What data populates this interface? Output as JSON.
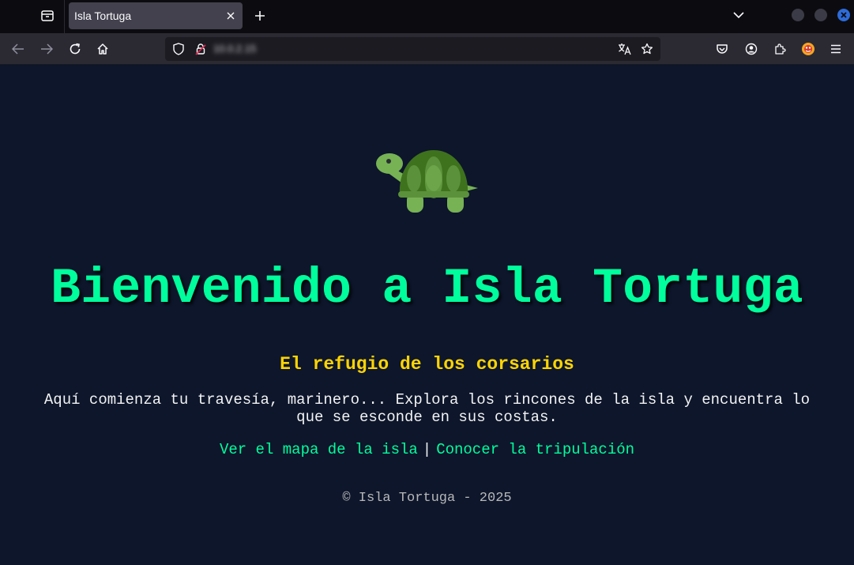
{
  "browser": {
    "tab": {
      "title": "Isla Tortuga"
    },
    "url": "10.0.2.15",
    "icons": {
      "tab_list": "tab-list-icon",
      "close_tab": "close-icon",
      "new_tab": "plus-icon",
      "overflow": "chevron-down-icon",
      "back": "back-arrow-icon",
      "forward": "forward-arrow-icon",
      "reload": "reload-icon",
      "home": "home-icon",
      "shield": "shield-icon",
      "lock": "lock-icon",
      "translate": "translate-icon",
      "bookmark": "star-icon",
      "pocket": "pocket-icon",
      "account": "account-icon",
      "extensions": "puzzle-icon",
      "extension_avatar": "extension-avatar-icon",
      "menu": "hamburger-menu-icon"
    },
    "colors": {
      "tabstrip": "#0c0c10",
      "toolbar": "#2b2a33",
      "active_tab": "#42414d",
      "urlbar": "#1c1b22",
      "close_window": "#2d6bd8"
    }
  },
  "page": {
    "emoji": "turtle",
    "title": "Bienvenido a Isla Tortuga",
    "subtitle": "El refugio de los corsarios",
    "intro": "Aquí comienza tu travesía, marinero... Explora los rincones de la isla y encuentra lo que se esconde en sus costas.",
    "links": [
      {
        "label": "Ver el mapa de la isla"
      },
      {
        "label": "Conocer la tripulación"
      }
    ],
    "link_separator": "|",
    "footer": "© Isla Tortuga - 2025",
    "colors": {
      "background": "#0d162b",
      "accent_green": "#00ff9c",
      "accent_yellow": "#ffd400",
      "text": "#f3f3f3",
      "footer_text": "#b8b8b8"
    }
  }
}
